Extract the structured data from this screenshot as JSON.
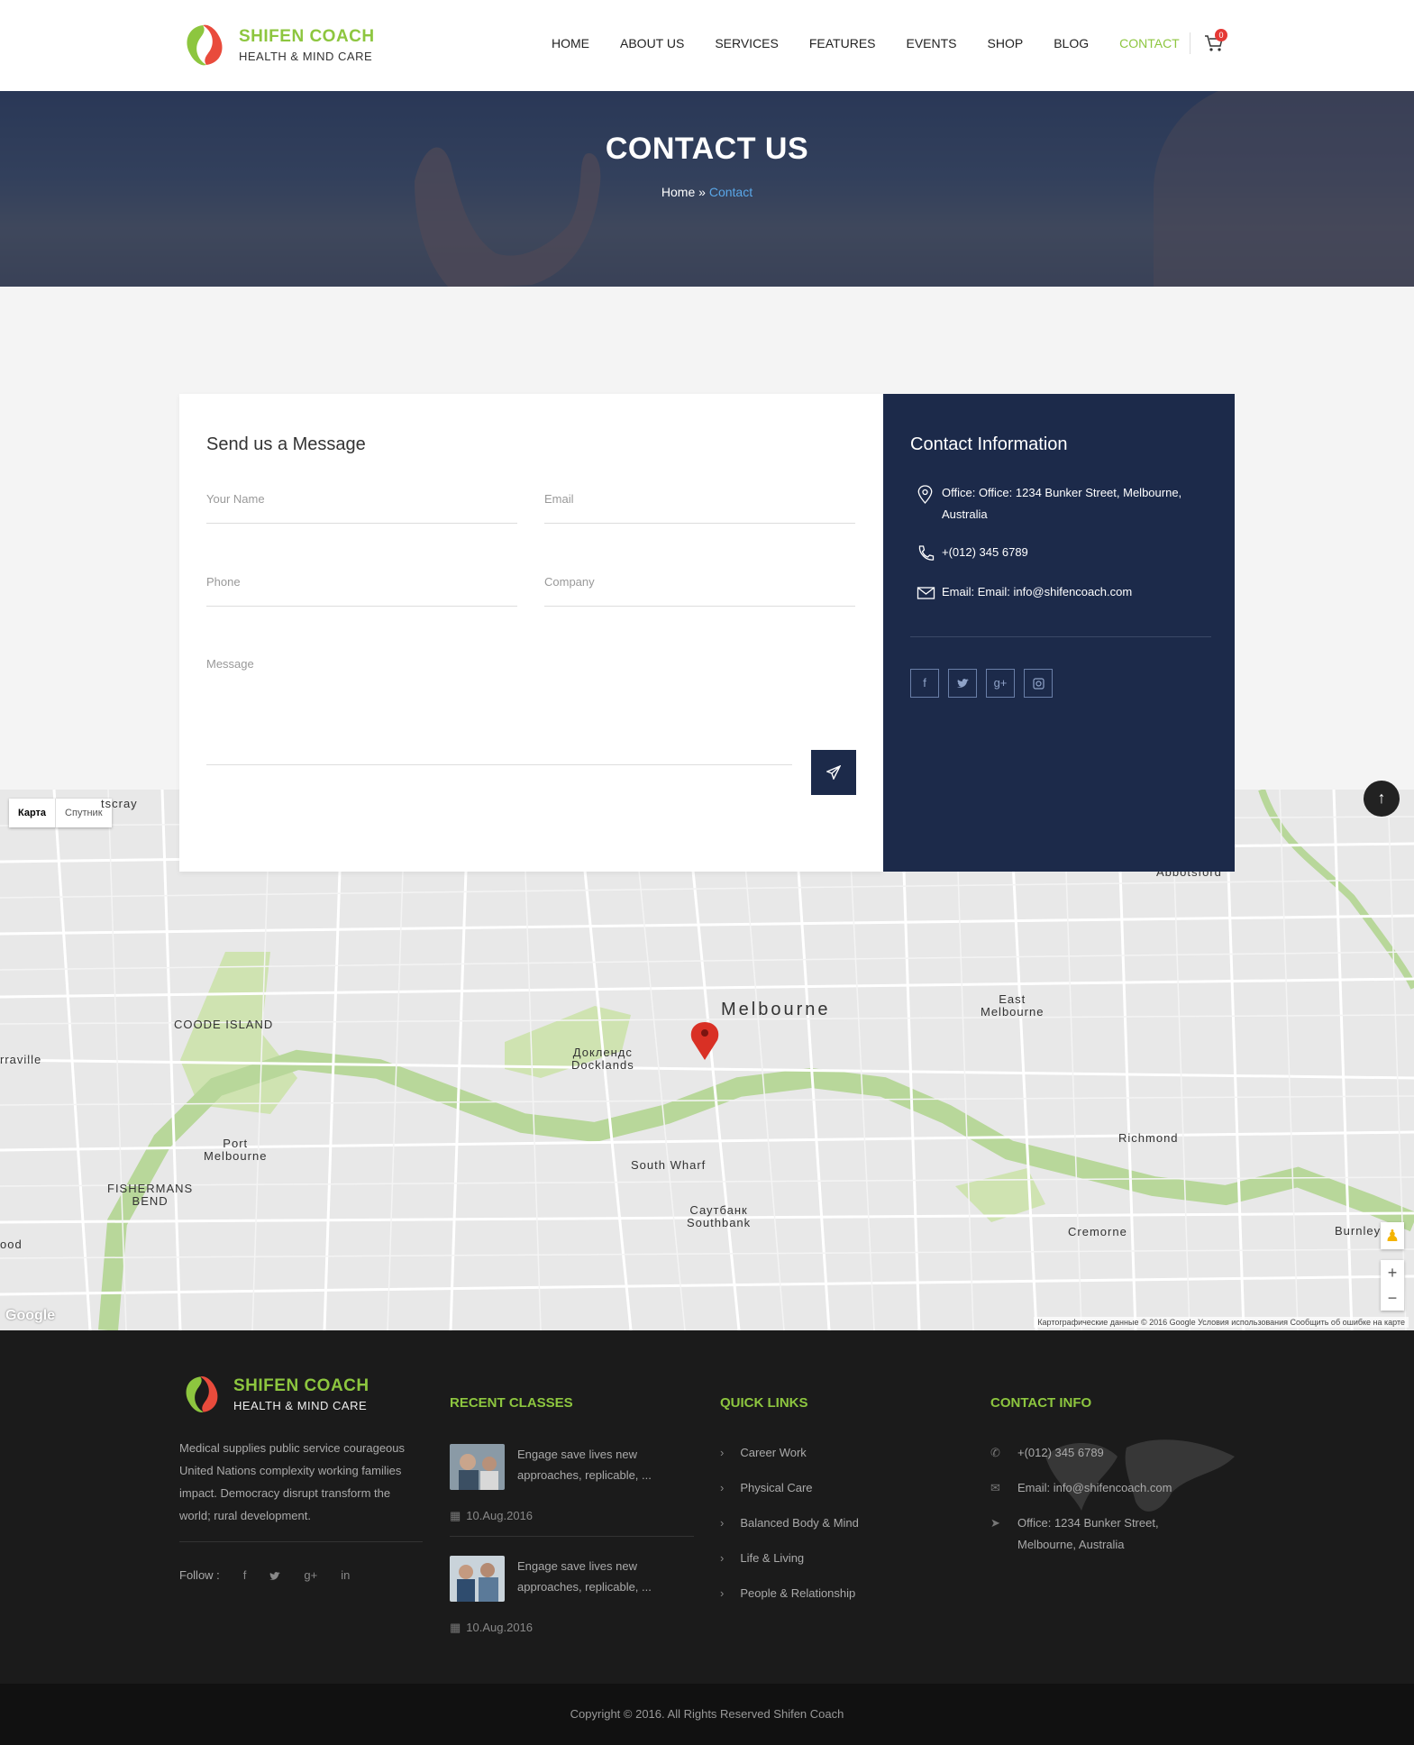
{
  "brand": {
    "name": "SHIFEN COACH",
    "tagline": "HEALTH & MIND CARE",
    "accent": "#8dc63f",
    "navy": "#1c2a4a"
  },
  "nav": {
    "items": [
      {
        "label": "HOME"
      },
      {
        "label": "ABOUT US"
      },
      {
        "label": "SERVICES"
      },
      {
        "label": "FEATURES"
      },
      {
        "label": "EVENTS"
      },
      {
        "label": "SHOP"
      },
      {
        "label": "BLOG"
      },
      {
        "label": "CONTACT",
        "active": true
      }
    ],
    "cart_count": "0",
    "cart_icon": "cart-icon"
  },
  "hero": {
    "title": "CONTACT US",
    "breadcrumb_home": "Home",
    "breadcrumb_sep": "»",
    "breadcrumb_current": "Contact"
  },
  "form": {
    "title": "Send us a Message",
    "name_placeholder": "Your Name",
    "email_placeholder": "Email",
    "phone_placeholder": "Phone",
    "company_placeholder": "Company",
    "message_placeholder": "Message",
    "send_icon": "paper-plane-icon"
  },
  "contact_info": {
    "title": "Contact Information",
    "address": "Office: Office: 1234 Bunker Street, Melbourne, Australia",
    "phone": "+(012) 345 6789",
    "email": "Email: Email: info@shifencoach.com",
    "socials": [
      "facebook-icon",
      "twitter-icon",
      "google-plus-icon",
      "instagram-icon"
    ]
  },
  "map": {
    "tab_map": "Карта",
    "tab_satellite": "Спутник",
    "labels": {
      "melbourne": "Melbourne",
      "docklands_ru": "Доклендс",
      "docklands": "Docklands",
      "coode_island": "COODE ISLAND",
      "port_melbourne_1": "Port",
      "port_melbourne_2": "Melbourne",
      "fishermans_1": "FISHERMANS",
      "fishermans_2": "BEND",
      "south_wharf": "South Wharf",
      "southbank_ru": "Саутбанк",
      "southbank": "Southbank",
      "east_melbourne_1": "East",
      "east_melbourne_2": "Melbourne",
      "richmond": "Richmond",
      "cremorne": "Cremorne",
      "burnley": "Burnley",
      "abbotsford": "Abbotsford",
      "footscray": "tscray",
      "yarraville": "rraville",
      "ood": "ood"
    },
    "attribution": "Картографические данные © 2016 Google   Условия использования   Сообщить об ошибке на карте",
    "google": "Google",
    "zoom_in": "+",
    "zoom_out": "−"
  },
  "footer": {
    "about": "Medical supplies public service courageous United Nations complexity working families impact. Democracy disrupt transform the world; rural development.",
    "follow_label": "Follow :",
    "follow_icons": [
      "facebook-icon",
      "twitter-icon",
      "google-plus-icon",
      "linkedin-icon"
    ],
    "recent_title": "RECENT CLASSES",
    "recent": [
      {
        "title": "Engage save lives new approaches, replicable, ...",
        "date": "10.Aug.2016"
      },
      {
        "title": "Engage save lives new approaches, replicable, ...",
        "date": "10.Aug.2016"
      }
    ],
    "quick_title": "QUICK LINKS",
    "quick_links": [
      "Career Work",
      "Physical Care",
      "Balanced Body & Mind",
      "Life & Living",
      "People & Relationship"
    ],
    "contact_title": "CONTACT INFO",
    "contact_phone": "+(012) 345 6789",
    "contact_email": "Email: info@shifencoach.com",
    "contact_address": "Office: 1234 Bunker Street, Melbourne, Australia",
    "copyright": "Copyright © 2016. All Rights Reserved Shifen Coach"
  }
}
